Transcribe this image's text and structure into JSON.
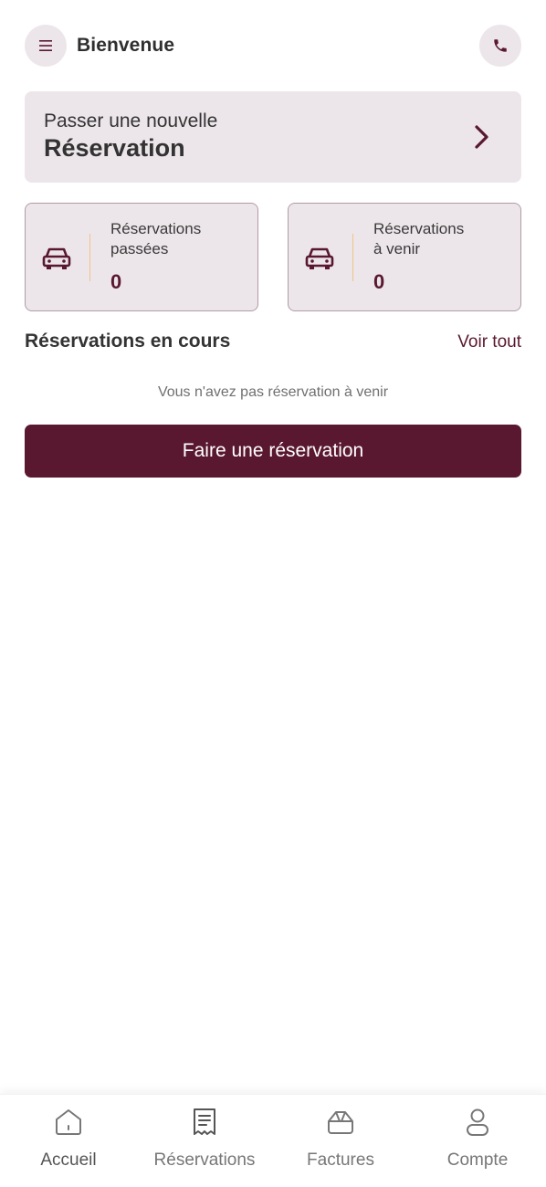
{
  "header": {
    "title": "Bienvenue",
    "menu_icon": "menu-icon",
    "phone_icon": "phone-icon"
  },
  "new_reservation": {
    "line1": "Passer une nouvelle",
    "line2": "Réservation",
    "icon": "chevron-right-icon"
  },
  "stats": [
    {
      "label_line1": "Réservations",
      "label_line2": "passées",
      "count": "0",
      "icon": "car-icon"
    },
    {
      "label_line1": "Réservations",
      "label_line2": "à venir",
      "count": "0",
      "icon": "car-icon"
    }
  ],
  "current_section": {
    "title": "Réservations en cours",
    "see_all": "Voir tout",
    "empty_message": "Vous n'avez pas réservation à venir"
  },
  "cta": {
    "label": "Faire une réservation"
  },
  "tabbar": {
    "items": [
      {
        "label": "Accueil",
        "icon": "home-icon"
      },
      {
        "label": "Réservations",
        "icon": "receipt-icon"
      },
      {
        "label": "Factures",
        "icon": "invoice-icon"
      },
      {
        "label": "Compte",
        "icon": "user-icon"
      }
    ]
  },
  "colors": {
    "brand": "#5a1830",
    "card_bg": "#ece6ea",
    "divider_accent": "#f0c48a"
  }
}
